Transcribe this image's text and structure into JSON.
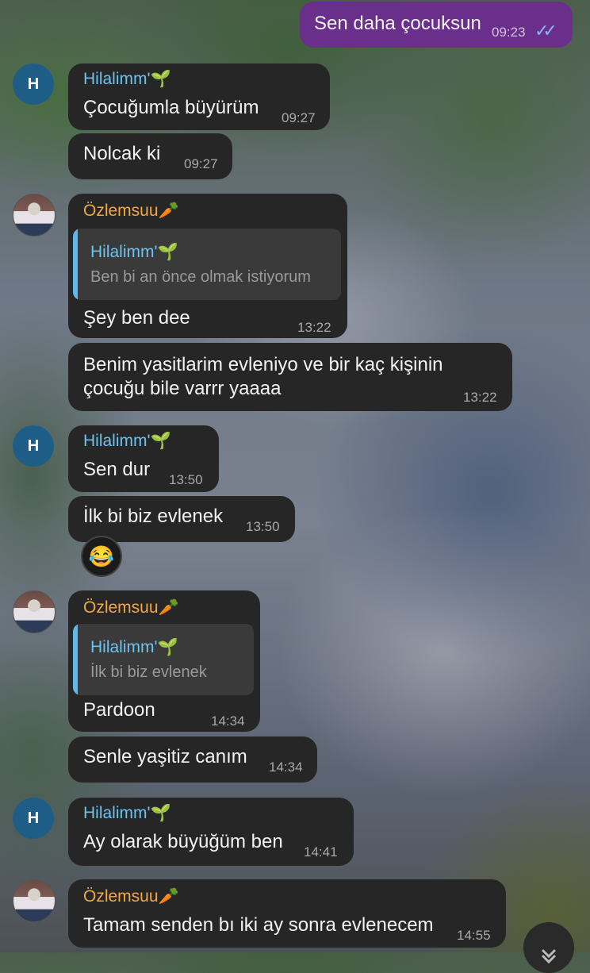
{
  "messages": {
    "m1": {
      "text": "Sen daha çocuksun",
      "time": "09:23",
      "ticks": "✓✓"
    },
    "g1": {
      "sender": "Hilalimm'🌱",
      "avatar": "H",
      "t1": "Çocuğumla büyürüm",
      "time1": "09:27",
      "t2": "Nolcak ki",
      "time2": "09:27"
    },
    "g2": {
      "sender": "Özlemsuu🥕",
      "quote_sender": "Hilalimm'🌱",
      "quote_text": "Ben bi an önce olmak istiyorum",
      "t1": "Şey ben dee",
      "time1": "13:22",
      "t2a": "Benim yasitlarim evleniyo ve bir kaç kişinin",
      "t2b": "çocuğu bile varrr yaaaa",
      "time2": "13:22"
    },
    "g3": {
      "sender": "Hilalimm'🌱",
      "avatar": "H",
      "t1": "Sen dur",
      "time1": "13:50",
      "t2": "İlk bi biz evlenek",
      "time2": "13:50",
      "reaction": "😂"
    },
    "g4": {
      "sender": "Özlemsuu🥕",
      "quote_sender": "Hilalimm'🌱",
      "quote_text": "İlk bi biz evlenek",
      "t1": "Pardoon",
      "time1": "14:34",
      "t2": "Senle yaşitiz canım",
      "time2": "14:34"
    },
    "g5": {
      "sender": "Hilalimm'🌱",
      "avatar": "H",
      "t1": "Ay olarak büyüğüm ben",
      "time1": "14:41"
    },
    "g6": {
      "sender": "Özlemsuu🥕",
      "t1": "Tamam senden bı iki ay sonra evlenecem",
      "time1": "14:55"
    }
  },
  "scroll_down_icon": "chevron-down-double",
  "colors": {
    "outgoing": "#6a2f8a",
    "incoming": "#262626",
    "name_blue": "#6cc3f0",
    "name_orange": "#f0a845"
  }
}
